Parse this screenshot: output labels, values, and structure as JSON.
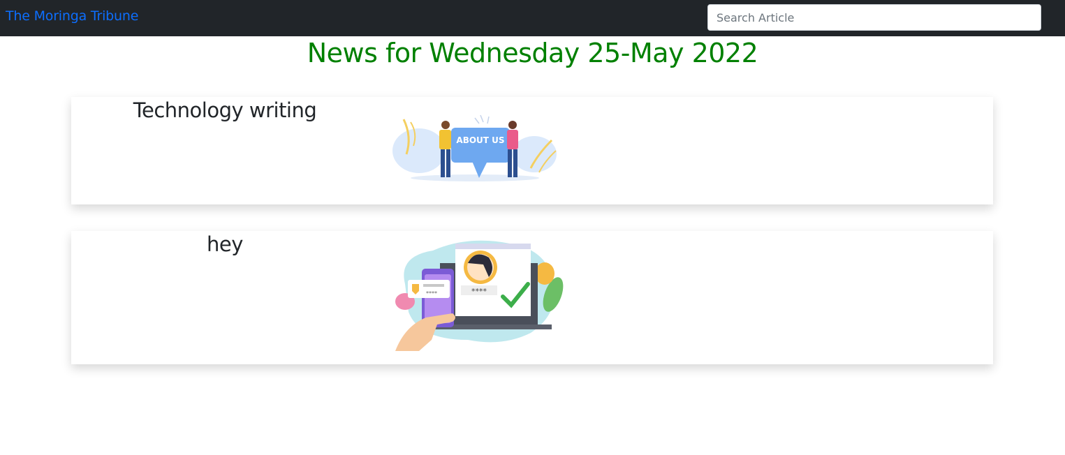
{
  "navbar": {
    "brand": "The Moringa Tribune",
    "search_placeholder": "Search Article"
  },
  "page": {
    "title": "News for Wednesday 25-May 2022"
  },
  "articles": [
    {
      "title": "Technology writing",
      "image": "about-us-illustration",
      "image_text": "ABOUT US"
    },
    {
      "title": "hey",
      "image": "secure-login-illustration",
      "image_text": "****"
    }
  ]
}
